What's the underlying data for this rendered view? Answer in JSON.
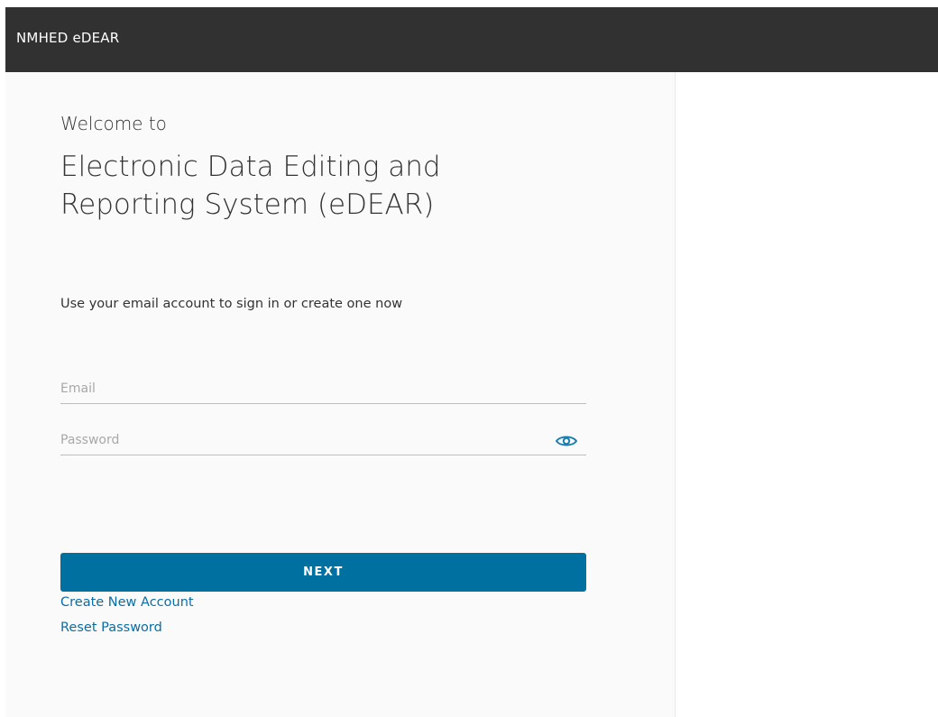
{
  "header": {
    "title": "NMHED eDEAR"
  },
  "login": {
    "welcome_text": "Welcome to",
    "system_name": "Electronic Data Editing and Reporting System (eDEAR)",
    "instruction": "Use your email account to sign in or create one now",
    "email": {
      "value": "",
      "placeholder": "Email"
    },
    "password": {
      "value": "",
      "placeholder": "Password",
      "toggle_icon": "eye-icon"
    },
    "next_label": "NEXT",
    "create_account_label": "Create New Account",
    "reset_password_label": "Reset Password"
  },
  "colors": {
    "header_bg": "#313131",
    "accent": "#0070a0",
    "link": "#0a6ea4"
  }
}
